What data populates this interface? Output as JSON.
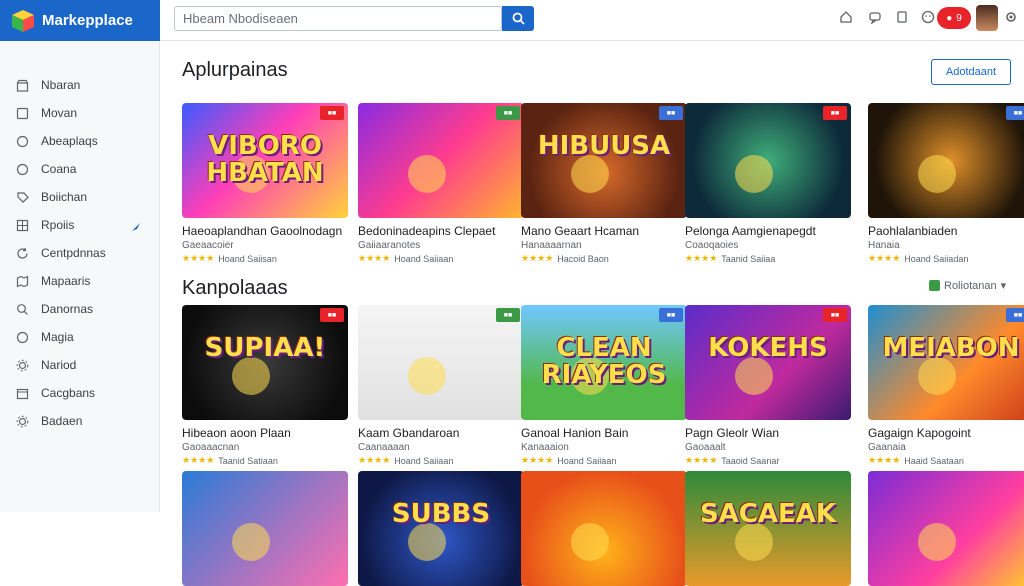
{
  "app": {
    "title": "Markepplace",
    "search_placeholder": "Hbeam Nbodiseaen",
    "notif_count": "9"
  },
  "sidebar": {
    "items": [
      {
        "label": "Nbaran",
        "icon": "store-icon"
      },
      {
        "label": "Movan",
        "icon": "square-icon"
      },
      {
        "label": "Abeaplaqs",
        "icon": "circle-icon"
      },
      {
        "label": "Coana",
        "icon": "circle-icon"
      },
      {
        "label": "Boiichan",
        "icon": "tag-icon"
      },
      {
        "label": "Rpoiis",
        "icon": "grid-icon"
      },
      {
        "label": "Centpdnnas",
        "icon": "refresh-icon"
      },
      {
        "label": "Mapaaris",
        "icon": "map-icon"
      },
      {
        "label": "Danornas",
        "icon": "search-icon"
      },
      {
        "label": "Magia",
        "icon": "circle-icon"
      },
      {
        "label": "Nariod",
        "icon": "gear-icon"
      },
      {
        "label": "Cacgbans",
        "icon": "calendar-icon"
      },
      {
        "label": "Badaen",
        "icon": "gear-icon"
      }
    ]
  },
  "sections": [
    {
      "title": "Aplurpainas",
      "action": "Adotdaant",
      "cards": [
        {
          "thumb_text": "VIBORO\nHBATAN",
          "title": "Haeoaplandhan Gaoolnodagn",
          "sub": "Gaeaacoier",
          "rating": "Hoand Saiisan",
          "badge_color": "#e8232a",
          "bg": "linear-gradient(135deg,#3b5bff,#ff3fb8 45%,#ffd23a)"
        },
        {
          "thumb_text": "",
          "title": "Bedoninadeapins Clepaet",
          "sub": "Gaiiaaranotes",
          "rating": "Hoand Saiiaan",
          "badge_color": "#3c9a46",
          "bg": "linear-gradient(135deg,#8a2be2,#ff3c8e 50%,#ffb52e)"
        },
        {
          "thumb_text": "HIBUUSA",
          "title": "Mano Geaart Hcaman",
          "sub": "Hanaaaarnan",
          "rating": "Hacoid Baon",
          "badge_color": "#3a6fd8",
          "bg": "radial-gradient(circle at 50% 60%,#d86a2a,#5a2312 70%)"
        },
        {
          "thumb_text": "",
          "title": "Pelonga Aamgienapegdt",
          "sub": "Coaoqaoies",
          "rating": "Taanid Saiiaa",
          "badge_color": "#e8232a",
          "bg": "radial-gradient(circle at 50% 50%,#3fae7a,#0d2a3a 75%)"
        },
        {
          "thumb_text": "",
          "title": "Paohlalanbiaden",
          "sub": "Hanaia",
          "rating": "Hoand Saiiadan",
          "badge_color": "#3a6fd8",
          "bg": "radial-gradient(circle at 50% 50%,#e0902a,#1e1408 75%)"
        }
      ]
    },
    {
      "title": "Kanpolaaas",
      "filter": "Roliotanan",
      "cards": [
        {
          "thumb_text": "SUPIAA!",
          "title": "Hibeaon aoon Plaan",
          "sub": "Gaoaaacnan",
          "rating": "Taanid Satiaan",
          "badge_color": "#e8232a",
          "bg": "radial-gradient(circle at 50% 50%,#3a3a3a,#0c0c0c 80%)"
        },
        {
          "thumb_text": "",
          "title": "Kaam Gbandaroan",
          "sub": "Caanaaaan",
          "rating": "Hoand Saiiaan",
          "badge_color": "#3c9a46",
          "bg": "linear-gradient(180deg,#f5f5f5,#e0e0e0)"
        },
        {
          "thumb_text": "CLEAN\nRIAYEOS",
          "title": "Ganoal Hanion Bain",
          "sub": "Kanaaaion",
          "rating": "Hoand Saiiaan",
          "badge_color": "#3a6fd8",
          "bg": "linear-gradient(180deg,#6fc8ff,#52b84a 70%)"
        },
        {
          "thumb_text": "KOKEHS",
          "title": "Pagn Gleolr Wian",
          "sub": "Gaoaaalt",
          "rating": "Taaoid Saanar",
          "badge_color": "#e8232a",
          "bg": "linear-gradient(135deg,#5b2cc9,#c02a9e 60%,#3a1b6e)"
        },
        {
          "thumb_text": "MEIABON",
          "title": "Gagaign Kapogoint",
          "sub": "Gaanaia",
          "rating": "Haaid Saataan",
          "badge_color": "#3a6fd8",
          "bg": "linear-gradient(135deg,#1f8fd0,#ff8a2a 60%,#c93d1b)"
        }
      ]
    }
  ],
  "bottom_row": [
    {
      "thumb_text": "",
      "bg": "linear-gradient(135deg,#2b7bd6,#ff6fb0)"
    },
    {
      "thumb_text": "SUBBS",
      "bg": "radial-gradient(circle at 50% 60%,#2f58c9,#0e1846 75%)"
    },
    {
      "thumb_text": "",
      "bg": "radial-gradient(circle at 50% 70%,#ffb31a,#e8501a 70%)"
    },
    {
      "thumb_text": "SACAEAK",
      "bg": "linear-gradient(180deg,#2e8a3a,#e89a2a)"
    },
    {
      "thumb_text": "",
      "bg": "linear-gradient(135deg,#7b2cd6,#ff3fa0 60%,#ffce2a)"
    }
  ],
  "colors": {
    "brand": "#1a66c9",
    "accent": "#e8232a",
    "star": "#f2b400"
  }
}
